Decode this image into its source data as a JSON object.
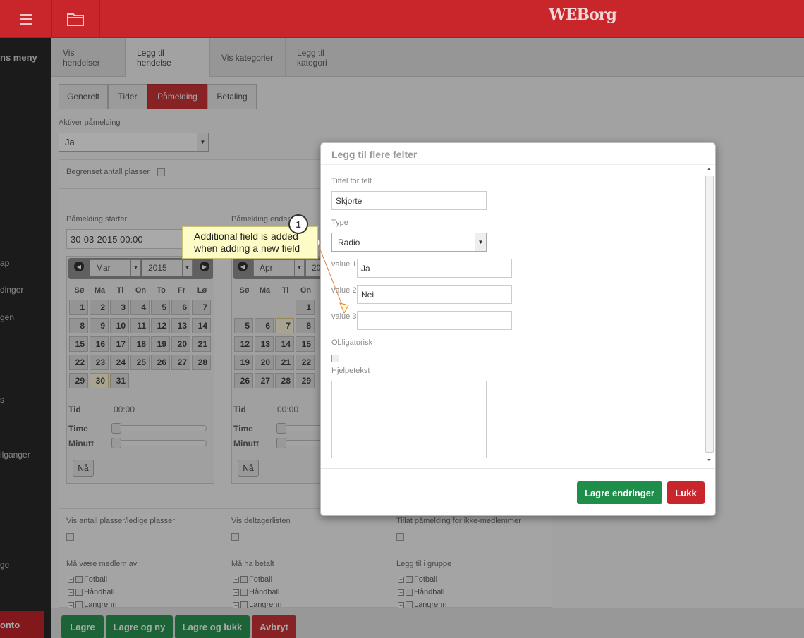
{
  "topbar": {
    "logo": "WEBorg"
  },
  "sidebar": {
    "title": "ns meny",
    "items": [
      "ap",
      "dinger",
      "gen",
      "s",
      "ilganger",
      "ge"
    ],
    "konto": "onto"
  },
  "tabs": [
    {
      "label": "Vis hendelser"
    },
    {
      "label": "Legg til hendelse"
    },
    {
      "label": "Vis kategorier"
    },
    {
      "label": "Legg til kategori"
    }
  ],
  "subtabs": [
    {
      "label": "Generelt"
    },
    {
      "label": "Tider"
    },
    {
      "label": "Påmelding"
    },
    {
      "label": "Betaling"
    }
  ],
  "form": {
    "aktiver_label": "Aktiver påmelding",
    "aktiver_value": "Ja",
    "begrenset_label": "Begrenset antall plasser",
    "start_label": "Påmelding starter",
    "start_value": "30-03-2015 00:00",
    "end_label": "Påmelding ender",
    "vis_antall": "Vis antall plasser/ledige plasser",
    "vis_deltager": "Vis deltagerlisten",
    "tillat": "Tillat påmelding for ikke-medlemmer",
    "medlem_av": "Må være medlem av",
    "ma_ha_betalt": "Må ha betalt",
    "legg_til_gruppe": "Legg til i gruppe",
    "groups": [
      "Fotball",
      "Håndball",
      "Langrenn"
    ]
  },
  "cal1": {
    "month": "Mar",
    "year": "2015",
    "dow": [
      "Sø",
      "Ma",
      "Ti",
      "On",
      "To",
      "Fr",
      "Lø"
    ],
    "tid_label": "Tid",
    "tid_value": "00:00",
    "time_label": "Time",
    "minutt_label": "Minutt",
    "now_label": "Nå"
  },
  "cal2": {
    "month": "Apr",
    "year": "20",
    "dow": [
      "Sø",
      "Ma",
      "Ti",
      "On"
    ],
    "tid_label": "Tid",
    "tid_value": "00:00",
    "time_label": "Time",
    "minutt_label": "Minutt",
    "now_label": "Nå"
  },
  "bottom": {
    "lagre": "Lagre",
    "lagre_ny": "Lagre og ny",
    "lagre_lukk": "Lagre og lukk",
    "avbryt": "Avbryt"
  },
  "modal": {
    "title": "Legg til flere felter",
    "tittel_label": "Tittel for felt",
    "tittel_value": "Skjorte",
    "type_label": "Type",
    "type_value": "Radio",
    "values": [
      {
        "label": "value 1",
        "value": "Ja"
      },
      {
        "label": "value 2",
        "value": "Nei"
      },
      {
        "label": "value 3",
        "value": ""
      }
    ],
    "obligatorisk_label": "Obligatorisk",
    "hjelpetekst_label": "Hjelpetekst",
    "save_label": "Lagre endringer",
    "close_label": "Lukk"
  },
  "callout": {
    "number": "1",
    "line1": "Additional field is added",
    "line2": "when adding a new field"
  }
}
